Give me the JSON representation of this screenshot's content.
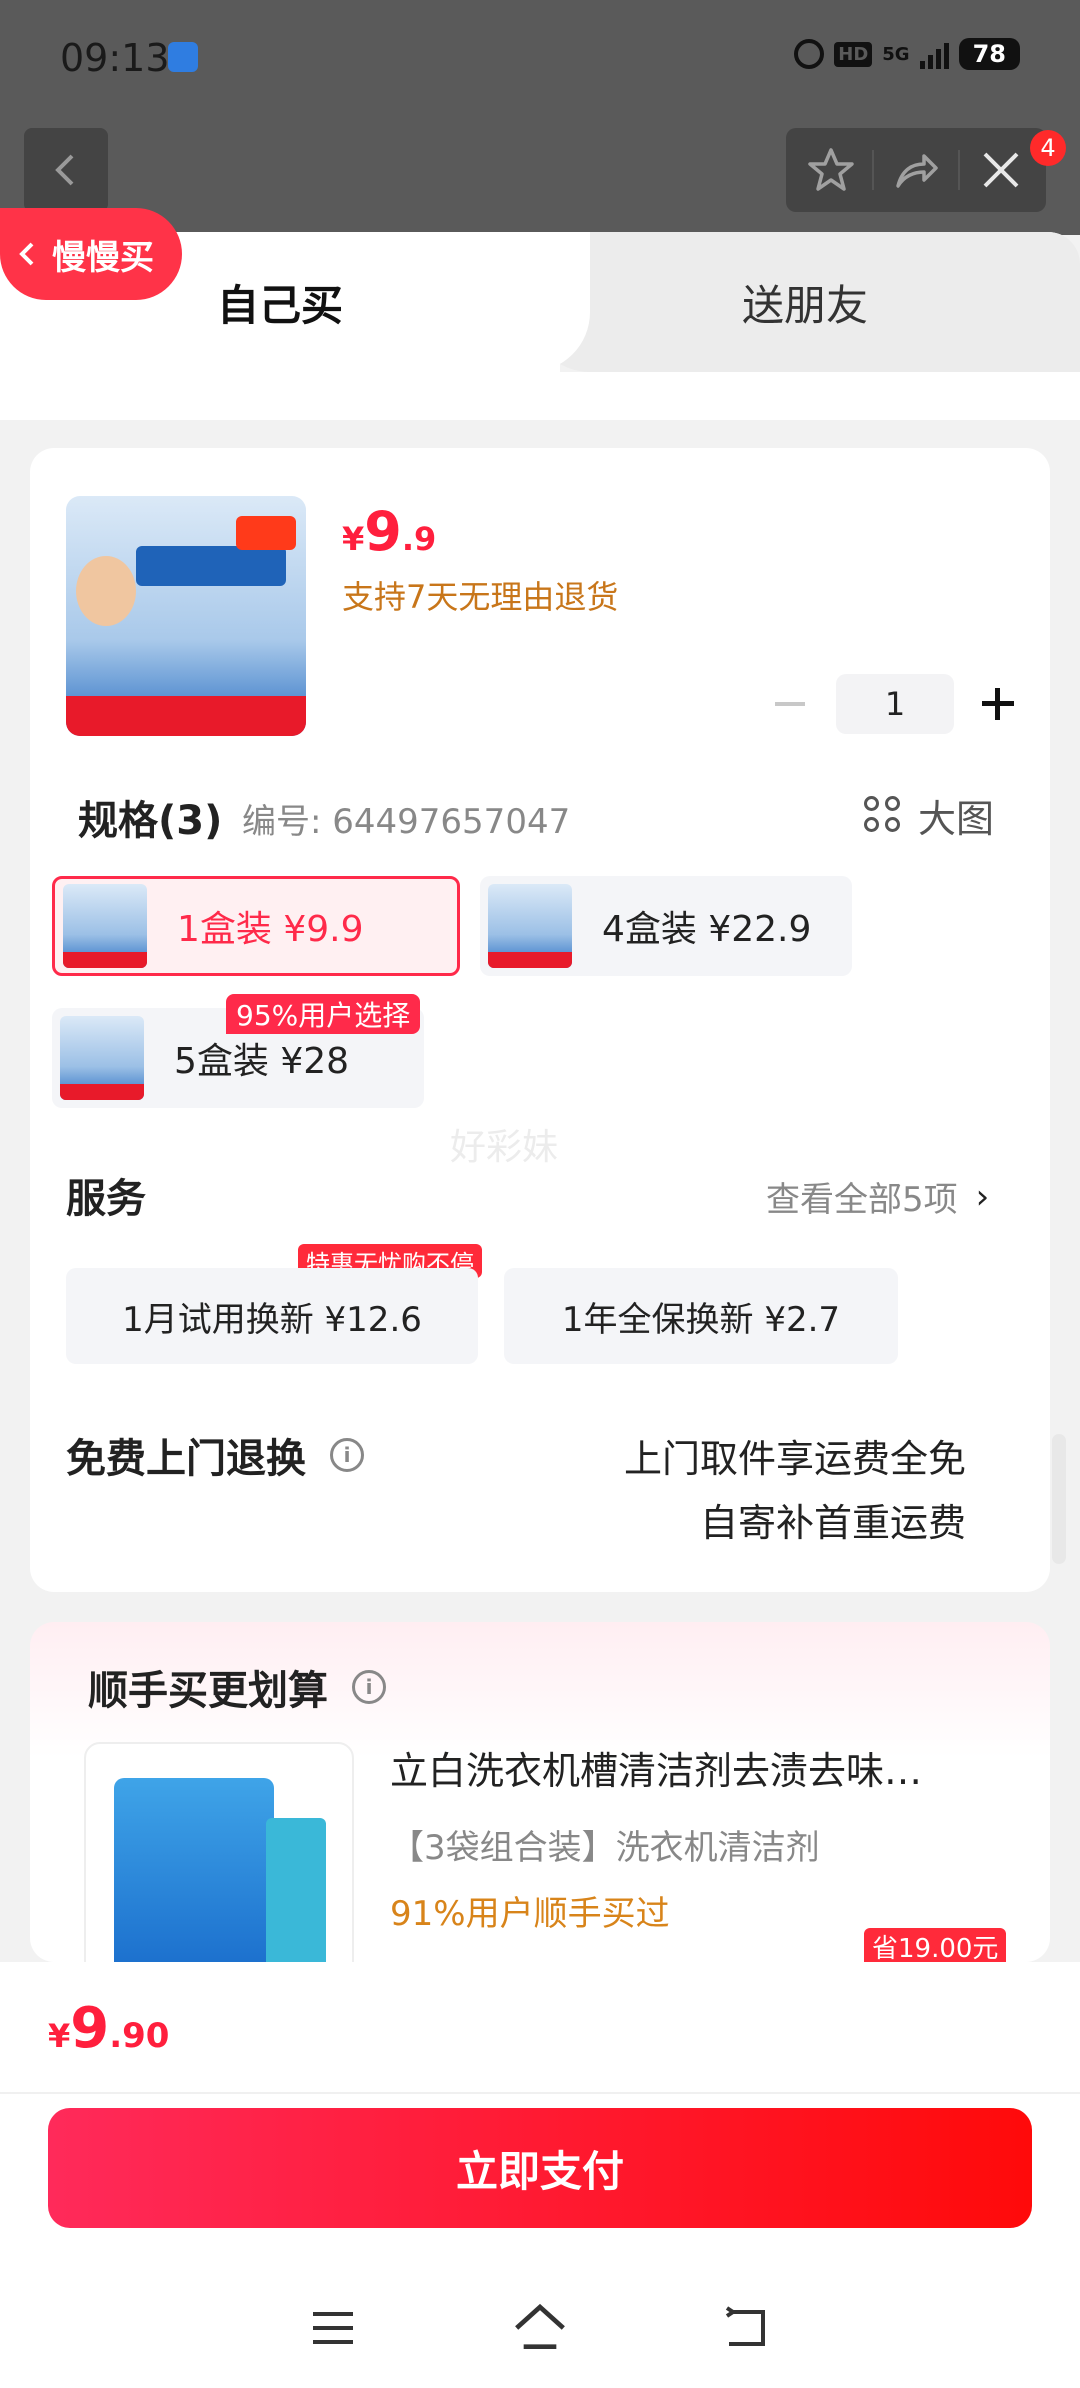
{
  "status_bar": {
    "time": "09:13",
    "hd": "HD",
    "network": "5G",
    "battery": "78"
  },
  "top_bar": {
    "notification_count": "4",
    "slow_buy_label": "慢慢买"
  },
  "tabs": [
    {
      "label": "自己买",
      "active": true
    },
    {
      "label": "送朋友",
      "active": false
    }
  ],
  "product": {
    "price_currency": "¥",
    "price_int": "9",
    "price_dec": ".9",
    "return_policy": "支持7天无理由退货",
    "quantity": "1"
  },
  "spec": {
    "title": "规格(3)",
    "code": "编号: 64497657047",
    "big_image_label": "大图",
    "popular_tag": "95%用户选择",
    "options": [
      {
        "label": "1盒装  ¥9.9",
        "selected": true
      },
      {
        "label": "4盒装  ¥22.9",
        "selected": false
      },
      {
        "label": "5盒装  ¥28",
        "selected": false
      }
    ]
  },
  "watermark": "好彩妹",
  "service": {
    "title": "服务",
    "view_all": "查看全部5项",
    "tag": "特惠无忧购不停",
    "options": [
      {
        "label": "1月试用换新  ¥12.6"
      },
      {
        "label": "1年全保换新  ¥2.7"
      }
    ]
  },
  "free_return": {
    "title": "免费上门退换",
    "line1": "上门取件享运费全免",
    "line2": "自寄补首重运费"
  },
  "bundle": {
    "title": "顺手买更划算",
    "name": "立白洗衣机槽清洁剂去渍去味…",
    "sub": "【3袋组合装】洗衣机清洁剂",
    "hot": "91%用户顺手买过",
    "save": "省19.00元"
  },
  "footer": {
    "total_currency": "¥",
    "total_int": "9",
    "total_dec": ".90",
    "pay_label": "立即支付"
  },
  "colors": {
    "accent": "#ff2a4a",
    "price": "#ff1f3d",
    "policy": "#c8761a"
  }
}
